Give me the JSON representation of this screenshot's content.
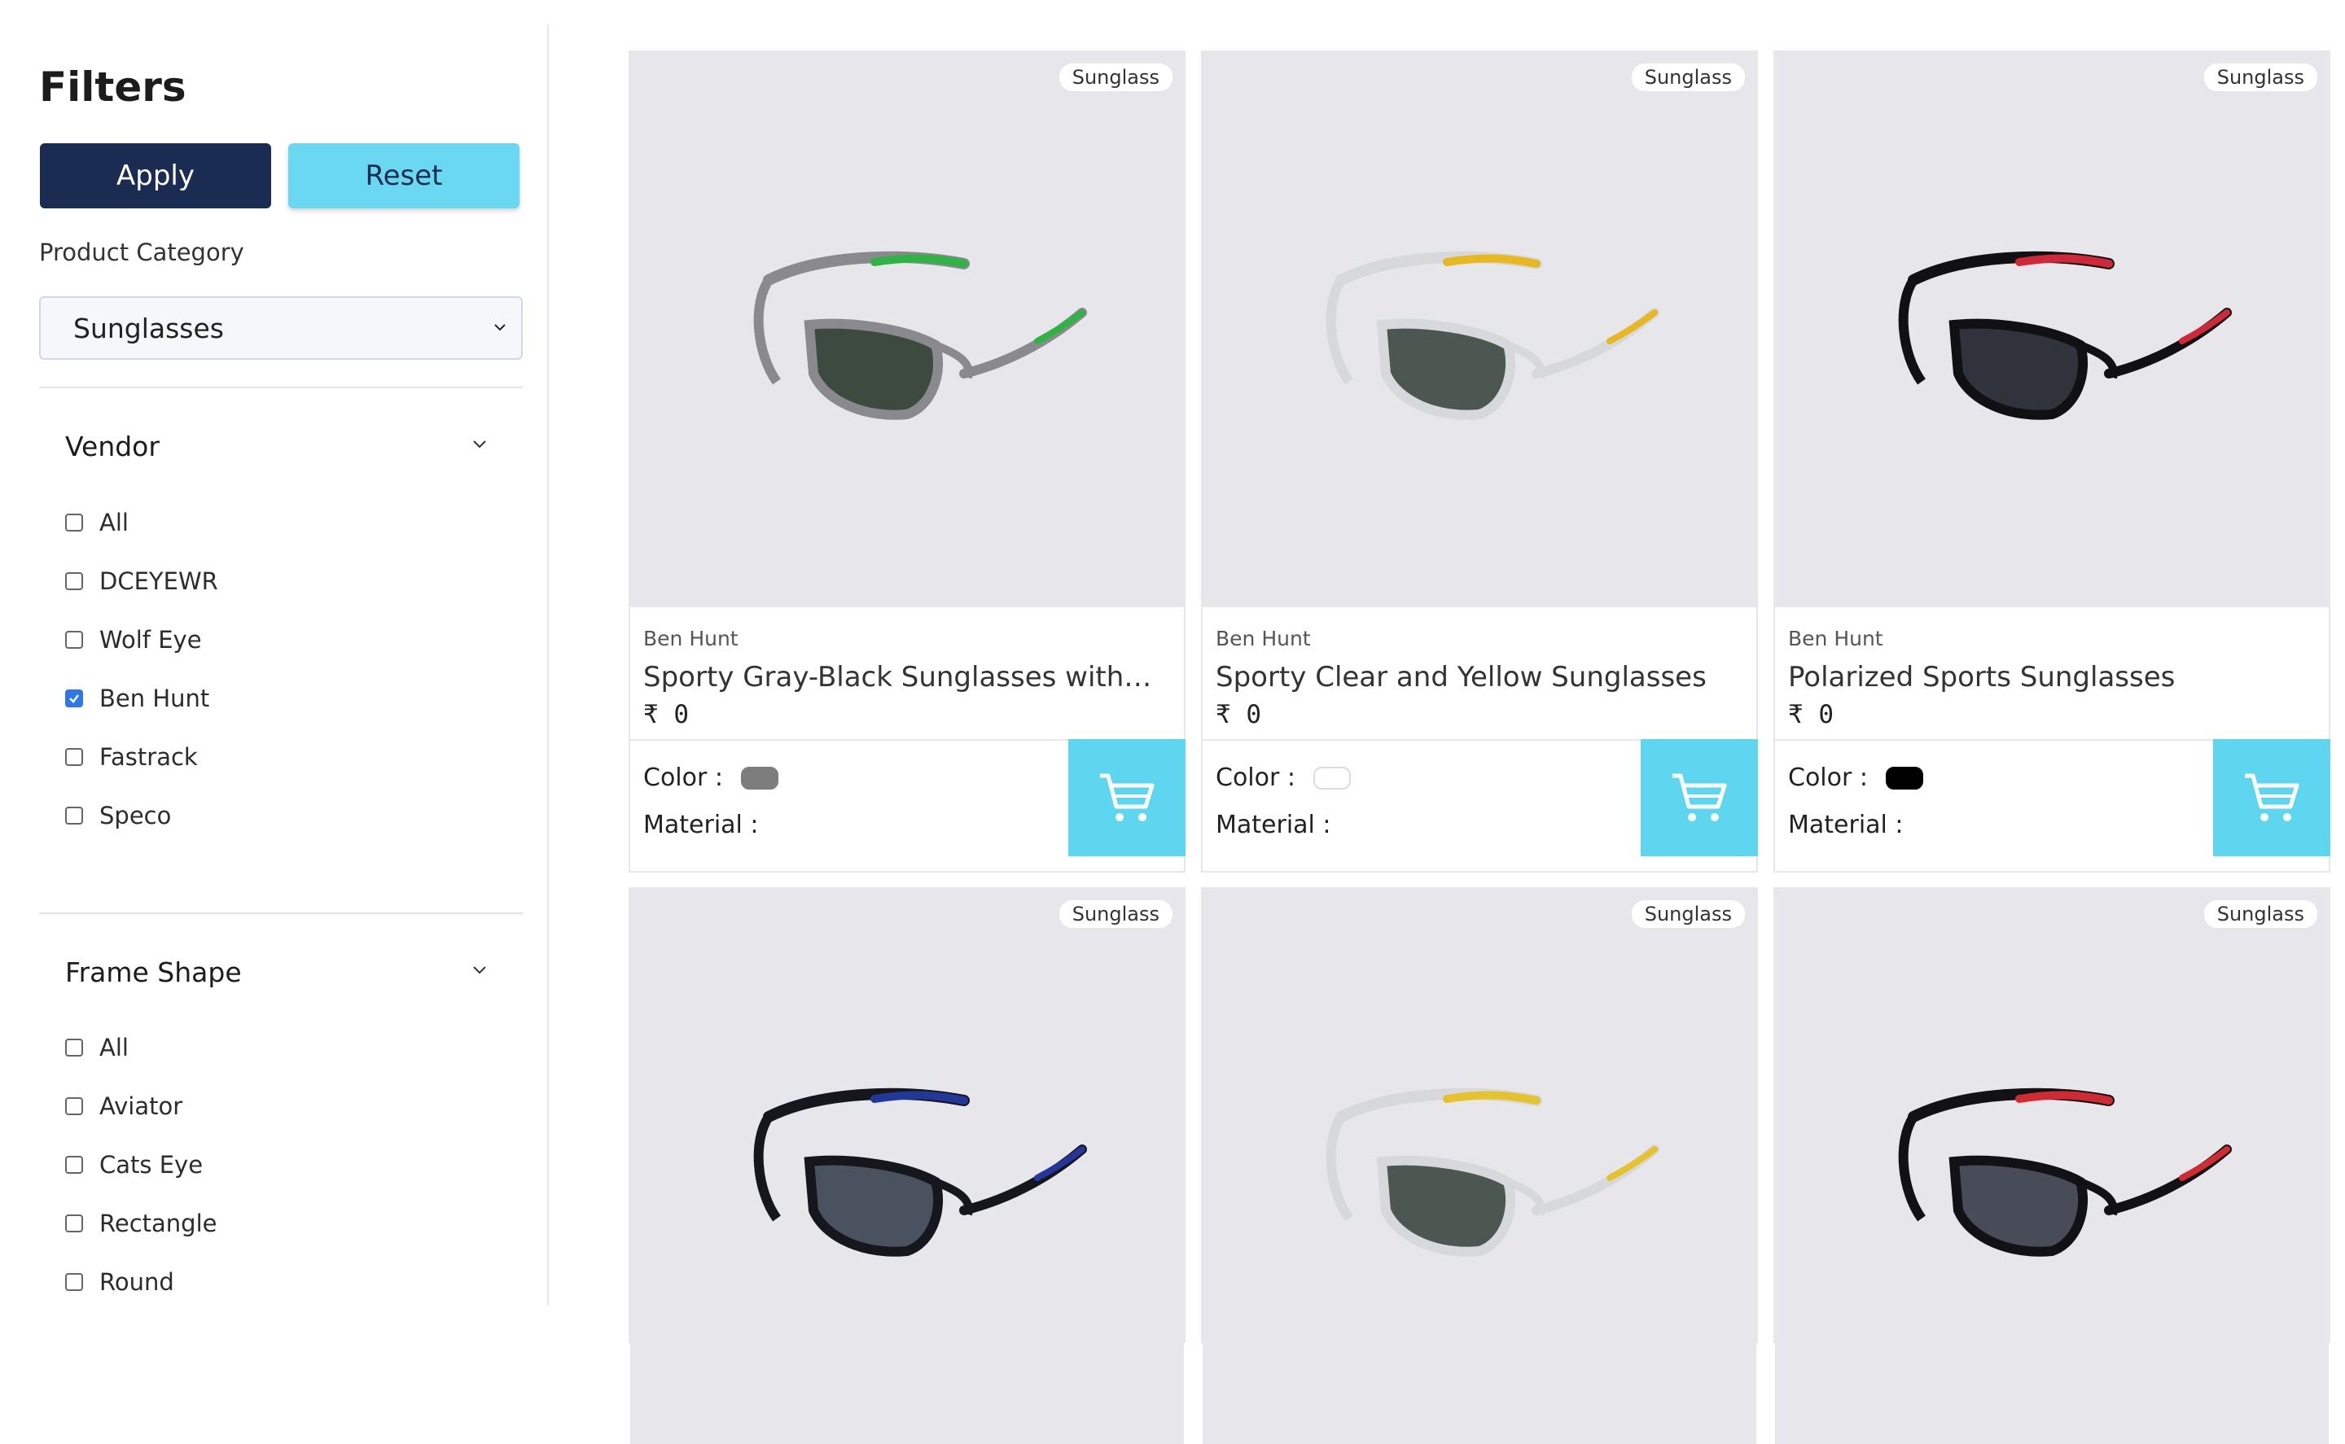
{
  "filters": {
    "title": "Filters",
    "apply_label": "Apply",
    "reset_label": "Reset",
    "category_label": "Product Category",
    "category_value": "Sunglasses"
  },
  "vendor": {
    "title": "Vendor",
    "options": [
      {
        "label": "All",
        "checked": false
      },
      {
        "label": "DCEYEWR",
        "checked": false
      },
      {
        "label": "Wolf Eye",
        "checked": false
      },
      {
        "label": "Ben Hunt",
        "checked": true
      },
      {
        "label": "Fastrack",
        "checked": false
      },
      {
        "label": "Speco",
        "checked": false
      }
    ]
  },
  "frame_shape": {
    "title": "Frame Shape",
    "options": [
      {
        "label": "All",
        "checked": false
      },
      {
        "label": "Aviator",
        "checked": false
      },
      {
        "label": "Cats Eye",
        "checked": false
      },
      {
        "label": "Rectangle",
        "checked": false
      },
      {
        "label": "Round",
        "checked": false
      }
    ]
  },
  "products": [
    {
      "badge": "Sunglass",
      "vendor": "Ben Hunt",
      "name": "Sporty Gray-Black Sunglasses with Gr...",
      "price": "₹ 0",
      "color_label": "Color  :",
      "color": "#7d7d7d",
      "material_label": "Material :",
      "frame_color": "#8a8a8e",
      "accent_color": "#2fb344",
      "lens_color": "#3d4a40"
    },
    {
      "badge": "Sunglass",
      "vendor": "Ben Hunt",
      "name": "Sporty Clear and Yellow Sunglasses",
      "price": "₹ 0",
      "color_label": "Color  :",
      "color": "#ffffff",
      "material_label": "Material :",
      "frame_color": "#d6d8dc",
      "accent_color": "#e8b820",
      "lens_color": "#4b5750"
    },
    {
      "badge": "Sunglass",
      "vendor": "Ben Hunt",
      "name": "Polarized Sports Sunglasses",
      "price": "₹ 0",
      "color_label": "Color  :",
      "color": "#000000",
      "material_label": "Material :",
      "frame_color": "#111114",
      "accent_color": "#d0283a",
      "lens_color": "#30333c"
    },
    {
      "badge": "Sunglass",
      "frame_color": "#16171c",
      "accent_color": "#23369a",
      "lens_color": "#4a5260"
    },
    {
      "badge": "Sunglass",
      "frame_color": "#d6d8dc",
      "accent_color": "#e6c22c",
      "lens_color": "#4b5750"
    },
    {
      "badge": "Sunglass",
      "frame_color": "#121216",
      "accent_color": "#d22a32",
      "lens_color": "#474c58"
    }
  ]
}
